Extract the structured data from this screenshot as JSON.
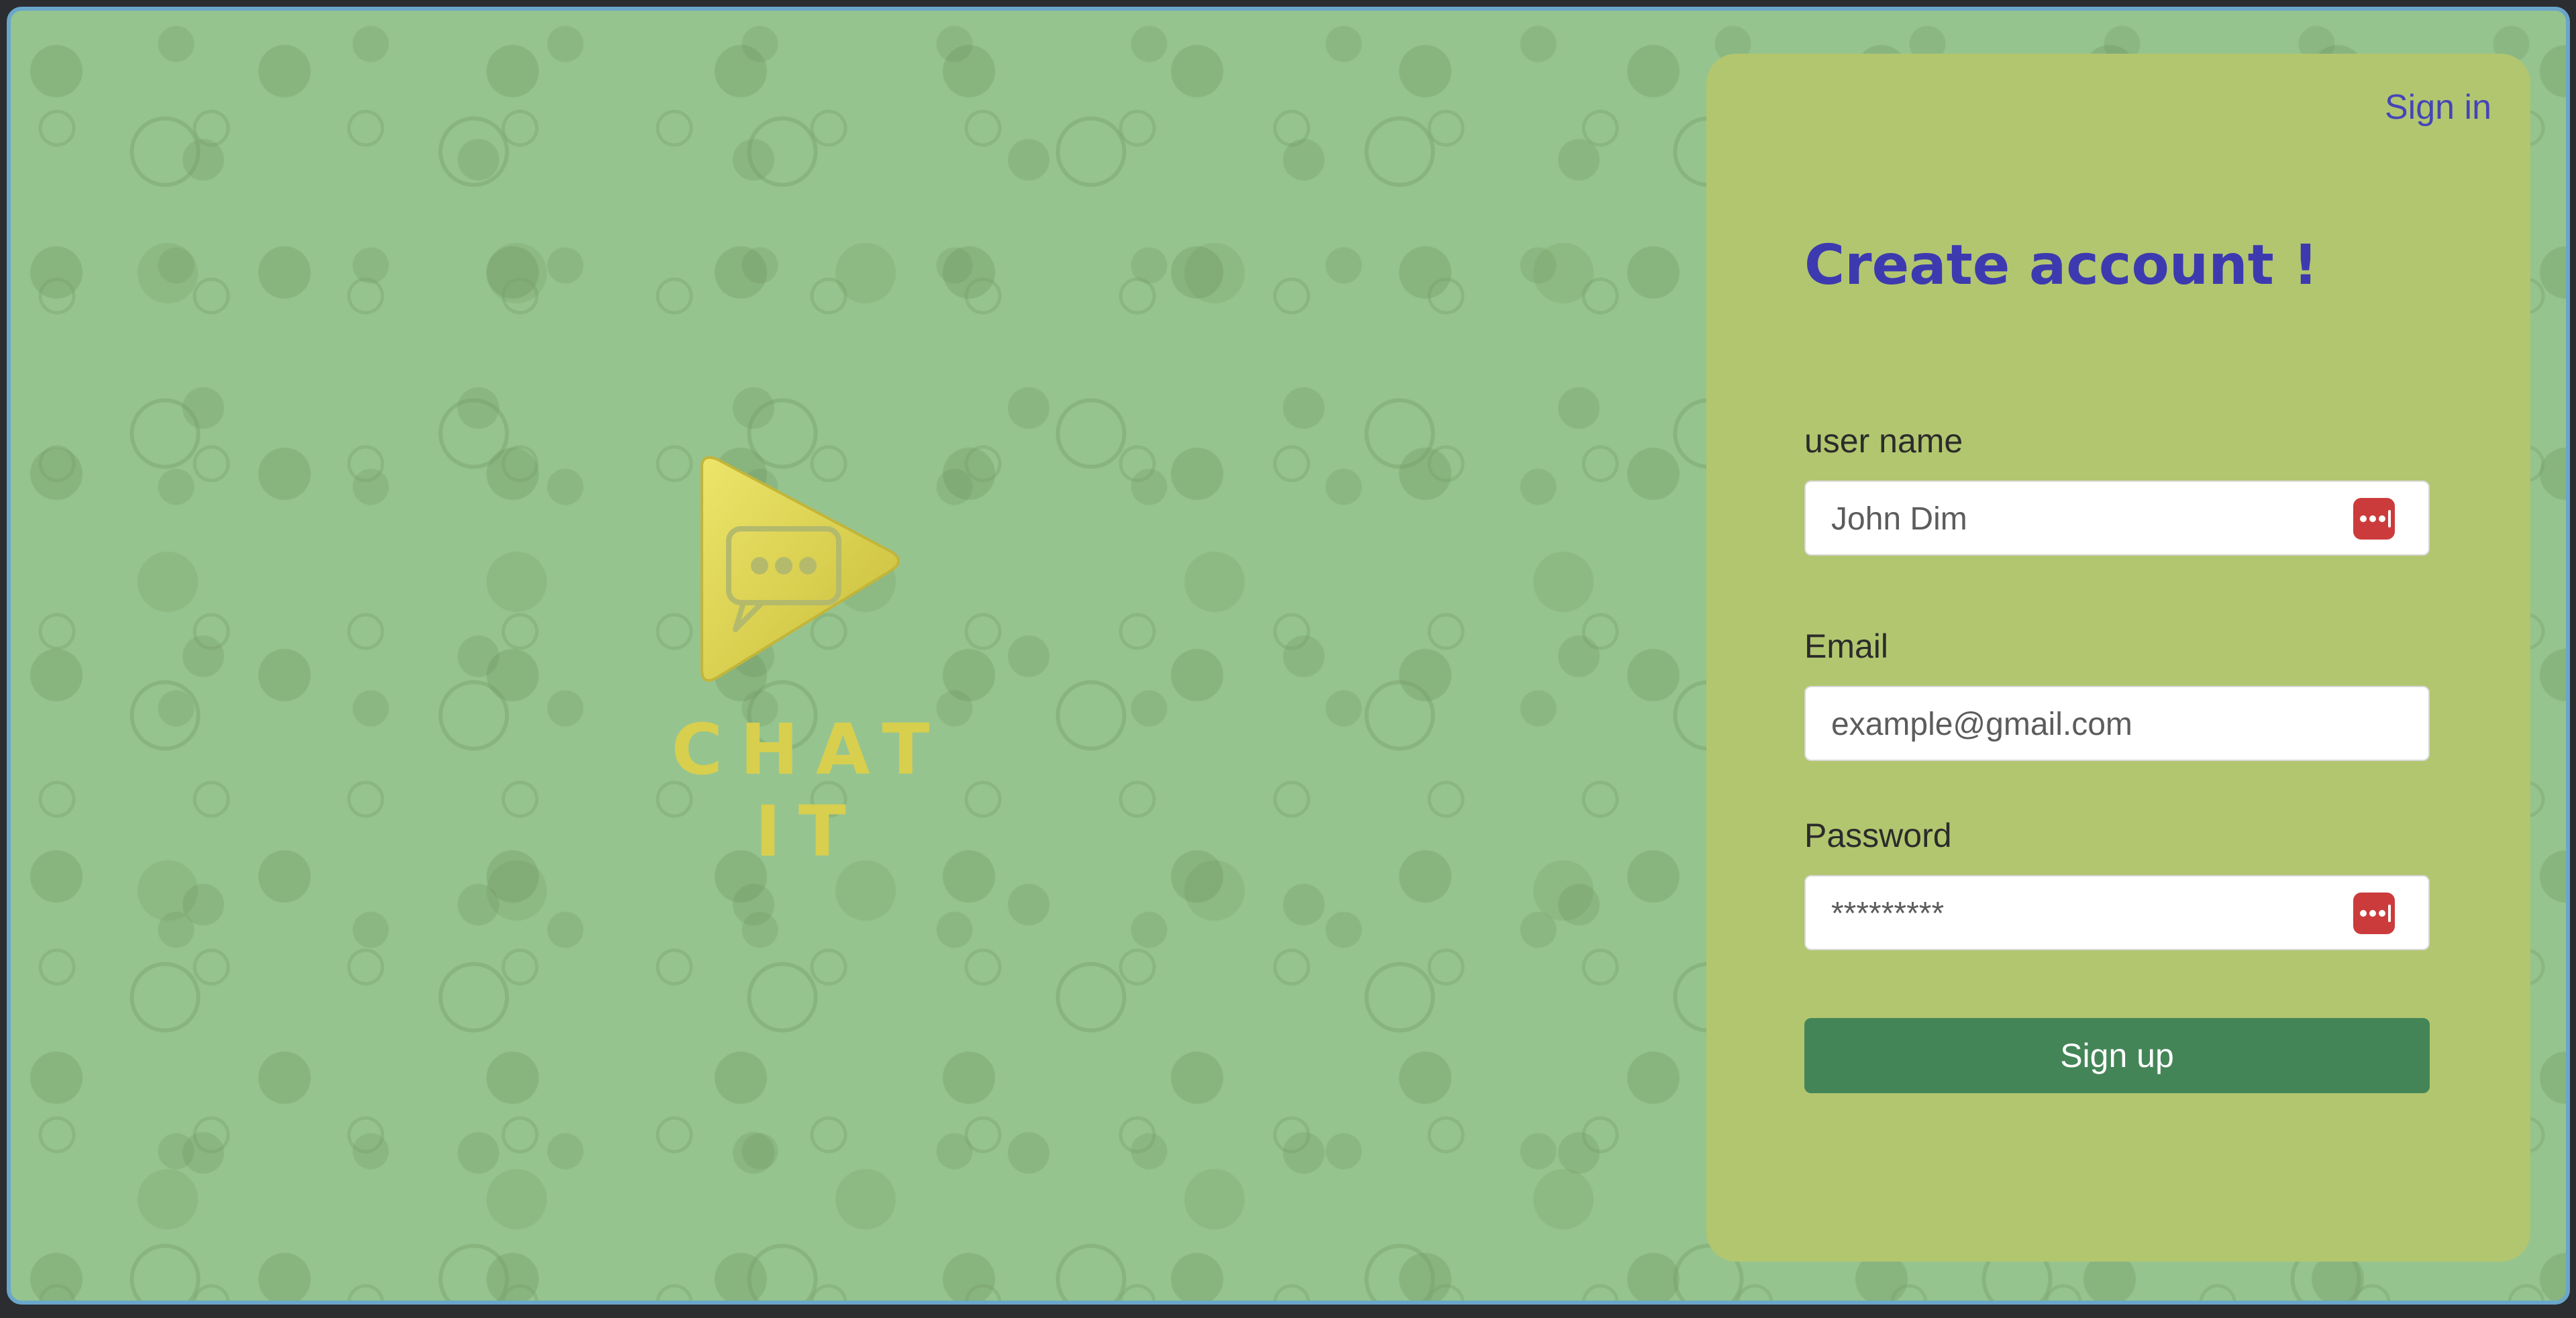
{
  "brand": {
    "name": "CHAT IT",
    "logo_icon": "play-chat-bubble-icon"
  },
  "header": {
    "signin_label": "Sign in"
  },
  "form": {
    "title": "Create account !",
    "fields": [
      {
        "label": "user name",
        "placeholder": "John Dim",
        "value": "",
        "icon": "password-manager-key-icon"
      },
      {
        "label": "Email",
        "placeholder": "example@gmail.com",
        "value": ""
      },
      {
        "label": "Password",
        "placeholder": "*********",
        "value": "",
        "icon": "password-manager-key-icon"
      }
    ],
    "submit_label": "Sign up"
  },
  "colors": {
    "background": "#96c48f",
    "panel": "#b2c66f",
    "title": "#3d3ab0",
    "link": "#4545b8",
    "button": "#448558",
    "logo": "#d8cf4e",
    "key_icon": "#cc3b3b"
  }
}
